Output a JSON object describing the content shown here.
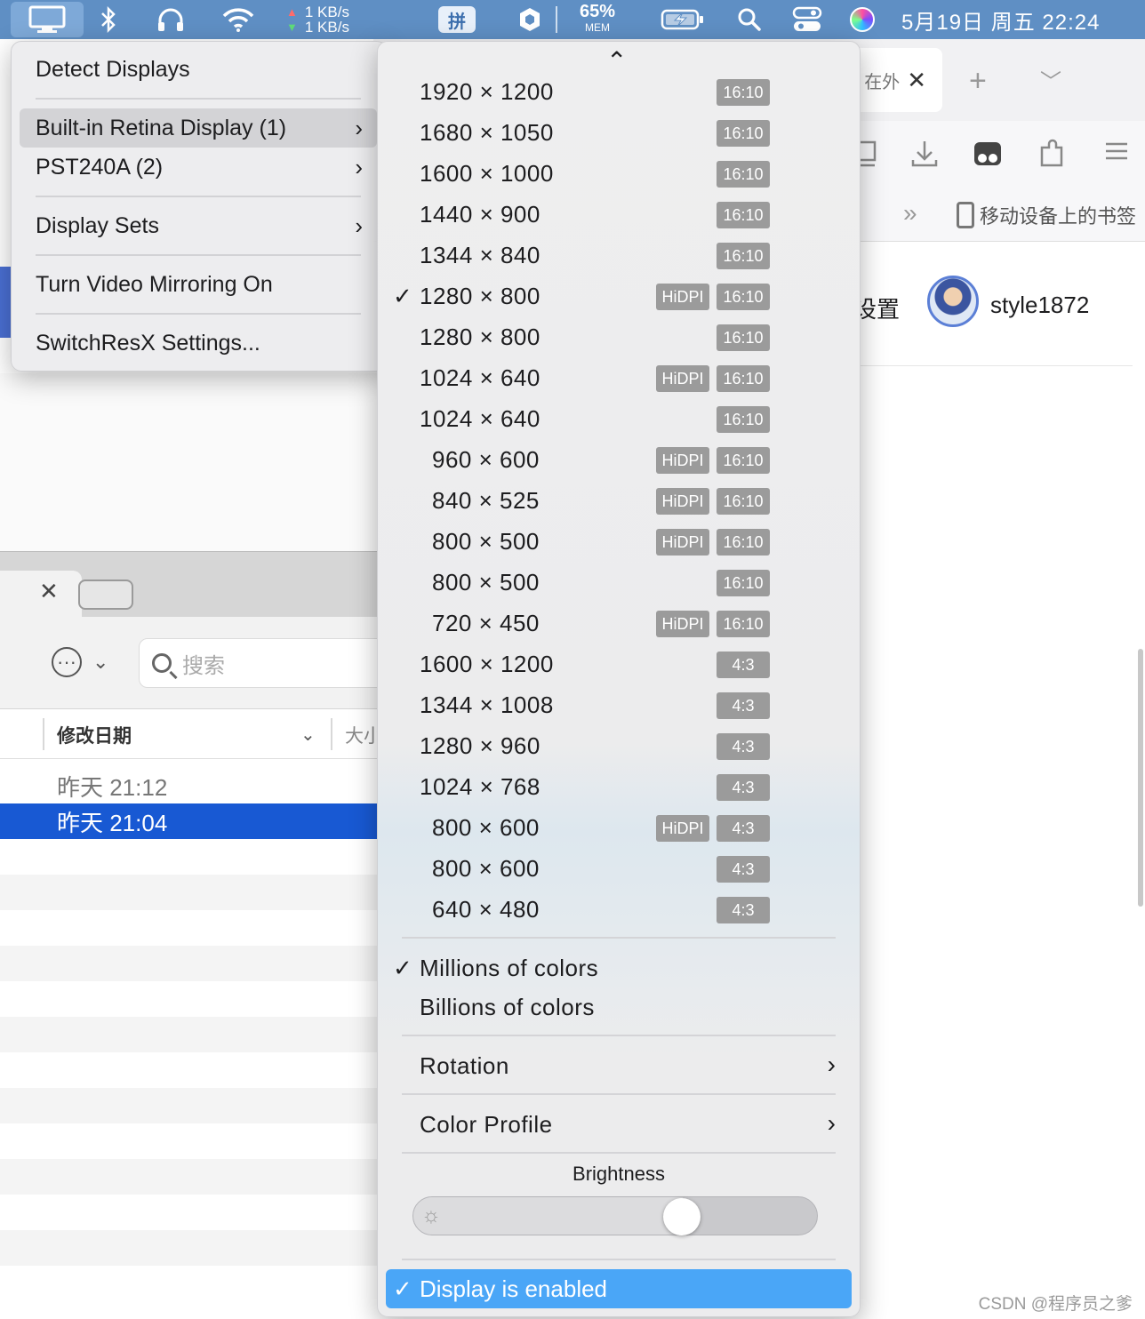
{
  "menubar": {
    "net_up": "1 KB/s",
    "net_down": "1 KB/s",
    "ime_label": "拼",
    "mem_percent": "65%",
    "mem_label": "MEM",
    "clock": "5月19日 周五  22:24",
    "icons": [
      "display-icon",
      "bluetooth-icon",
      "headphones-icon",
      "wifi-icon",
      "input-method-icon",
      "shield-icon",
      "battery-icon",
      "search-icon",
      "control-center-icon",
      "siri-icon"
    ]
  },
  "browser": {
    "tab_fragment": "在外",
    "bookmark_label": "移动设备上的书签",
    "settings_fragment": "设置",
    "username": "style1872"
  },
  "finder": {
    "search_placeholder": "搜索",
    "col_date": "修改日期",
    "col_size": "大小",
    "rows": [
      {
        "date": "昨天 21:12",
        "selected": false
      },
      {
        "date": "昨天 21:04",
        "selected": true
      }
    ]
  },
  "menu_left": {
    "detect": "Detect Displays",
    "builtin": "Built-in Retina Display (1)",
    "external": "PST240A (2)",
    "sets": "Display Sets",
    "mirroring": "Turn Video Mirroring On",
    "settings": "SwitchResX Settings..."
  },
  "menu_right": {
    "resolutions": [
      {
        "label": "1920 × 1200",
        "ratio": "16:10",
        "hidpi": false,
        "checked": false,
        "indent": false
      },
      {
        "label": "1680 × 1050",
        "ratio": "16:10",
        "hidpi": false,
        "checked": false,
        "indent": false
      },
      {
        "label": "1600 × 1000",
        "ratio": "16:10",
        "hidpi": false,
        "checked": false,
        "indent": false
      },
      {
        "label": "1440 × 900",
        "ratio": "16:10",
        "hidpi": false,
        "checked": false,
        "indent": false
      },
      {
        "label": "1344 × 840",
        "ratio": "16:10",
        "hidpi": false,
        "checked": false,
        "indent": false
      },
      {
        "label": "1280 × 800",
        "ratio": "16:10",
        "hidpi": true,
        "checked": true,
        "indent": false
      },
      {
        "label": "1280 × 800",
        "ratio": "16:10",
        "hidpi": false,
        "checked": false,
        "indent": false
      },
      {
        "label": "1024 × 640",
        "ratio": "16:10",
        "hidpi": true,
        "checked": false,
        "indent": false
      },
      {
        "label": "1024 × 640",
        "ratio": "16:10",
        "hidpi": false,
        "checked": false,
        "indent": false
      },
      {
        "label": "960 × 600",
        "ratio": "16:10",
        "hidpi": true,
        "checked": false,
        "indent": true
      },
      {
        "label": "840 × 525",
        "ratio": "16:10",
        "hidpi": true,
        "checked": false,
        "indent": true
      },
      {
        "label": "800 × 500",
        "ratio": "16:10",
        "hidpi": true,
        "checked": false,
        "indent": true
      },
      {
        "label": "800 × 500",
        "ratio": "16:10",
        "hidpi": false,
        "checked": false,
        "indent": true
      },
      {
        "label": "720 × 450",
        "ratio": "16:10",
        "hidpi": true,
        "checked": false,
        "indent": true
      },
      {
        "label": "1600 × 1200",
        "ratio": "4:3",
        "hidpi": false,
        "checked": false,
        "indent": false
      },
      {
        "label": "1344 × 1008",
        "ratio": "4:3",
        "hidpi": false,
        "checked": false,
        "indent": false
      },
      {
        "label": "1280 × 960",
        "ratio": "4:3",
        "hidpi": false,
        "checked": false,
        "indent": false
      },
      {
        "label": "1024 × 768",
        "ratio": "4:3",
        "hidpi": false,
        "checked": false,
        "indent": false
      },
      {
        "label": "800 × 600",
        "ratio": "4:3",
        "hidpi": true,
        "checked": false,
        "indent": true
      },
      {
        "label": "800 × 600",
        "ratio": "4:3",
        "hidpi": false,
        "checked": false,
        "indent": true
      },
      {
        "label": "640 × 480",
        "ratio": "4:3",
        "hidpi": false,
        "checked": false,
        "indent": true
      }
    ],
    "hidpi_label": "HiDPI",
    "millions": "Millions of colors",
    "billions": "Billions of colors",
    "rotation": "Rotation",
    "color_profile": "Color Profile",
    "brightness_label": "Brightness",
    "brightness_level": 0.68,
    "display_enabled": "Display is enabled"
  },
  "watermark": "CSDN @程序员之爹",
  "colors": {
    "menubar": "#5f8fc4",
    "selection": "#1859d3",
    "enabled_highlight": "#4aa6f7",
    "badge": "#9b9b9b"
  }
}
